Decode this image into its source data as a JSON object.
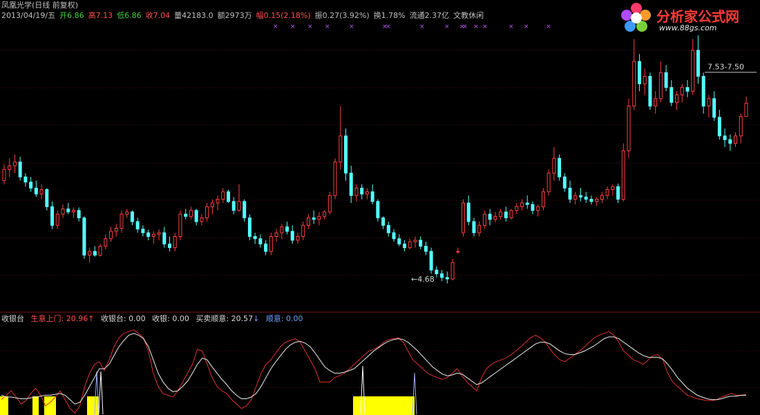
{
  "header": {
    "title": "凤凰光学(日线 前复权)",
    "date": "2013/04/19/五",
    "open_label": "开",
    "open": "6.86",
    "high_label": "高",
    "high": "7.13",
    "low_label": "低",
    "low": "6.86",
    "close_label": "收",
    "close": "7.04",
    "volume_label": "量",
    "volume": "42183.0",
    "amount_label": "额",
    "amount": "2973万",
    "change_label": "幅",
    "change": "0.15(2.18%)",
    "amplitude_label": "振",
    "amplitude": "0.27(3.92%)",
    "turnover_label": "换",
    "turnover": "1.78%",
    "float_label": "流通",
    "float": "2.37亿",
    "sector": "文教休闲"
  },
  "logo": {
    "title": "分析家公式网",
    "url": "www.88gs.com"
  },
  "indicator": {
    "name": "收银台",
    "s1_label": "生意上门:",
    "s1_value": "20.96",
    "s2_label": "收银台:",
    "s2_value": "0.00",
    "s3_label": "收银:",
    "s3_value": "0.00",
    "s4_label": "买卖顺意:",
    "s4_value": "20.57",
    "s5_label": "顺意:",
    "s5_value": "0.00"
  },
  "chart_data": [
    {
      "type": "candlestick",
      "title": "凤凰光学(日线 前复权)",
      "price_range": [
        4.3,
        8.1
      ],
      "annotations": [
        {
          "text": "7.53-7.50",
          "value": 7.52
        },
        {
          "text": "4.68",
          "value": 4.68
        }
      ],
      "colors": {
        "up": "#ff4040",
        "down": "#54ffff"
      },
      "candles": [
        [
          6.0,
          6.22,
          5.95,
          6.15
        ],
        [
          6.15,
          6.3,
          6.05,
          6.2
        ],
        [
          6.2,
          6.35,
          6.1,
          6.25
        ],
        [
          6.25,
          6.32,
          6.0,
          6.05
        ],
        [
          6.05,
          6.1,
          5.92,
          5.98
        ],
        [
          5.98,
          6.05,
          5.85,
          5.9
        ],
        [
          5.9,
          6.0,
          5.78,
          5.82
        ],
        [
          5.82,
          5.95,
          5.75,
          5.88
        ],
        [
          5.88,
          5.9,
          5.6,
          5.65
        ],
        [
          5.65,
          5.72,
          5.35,
          5.4
        ],
        [
          5.4,
          5.6,
          5.35,
          5.55
        ],
        [
          5.55,
          5.68,
          5.5,
          5.62
        ],
        [
          5.62,
          5.7,
          5.55,
          5.58
        ],
        [
          5.58,
          5.64,
          5.5,
          5.6
        ],
        [
          5.6,
          5.64,
          5.45,
          5.5
        ],
        [
          5.5,
          5.52,
          4.95,
          5.0
        ],
        [
          5.0,
          5.1,
          4.9,
          5.05
        ],
        [
          5.05,
          5.12,
          4.98,
          5.0
        ],
        [
          5.0,
          5.15,
          4.98,
          5.12
        ],
        [
          5.12,
          5.28,
          5.08,
          5.22
        ],
        [
          5.22,
          5.38,
          5.18,
          5.32
        ],
        [
          5.32,
          5.42,
          5.25,
          5.36
        ],
        [
          5.36,
          5.6,
          5.3,
          5.55
        ],
        [
          5.55,
          5.62,
          5.5,
          5.58
        ],
        [
          5.58,
          5.6,
          5.4,
          5.45
        ],
        [
          5.45,
          5.5,
          5.3,
          5.35
        ],
        [
          5.35,
          5.4,
          5.25,
          5.3
        ],
        [
          5.3,
          5.34,
          5.2,
          5.25
        ],
        [
          5.25,
          5.32,
          5.15,
          5.28
        ],
        [
          5.28,
          5.35,
          5.2,
          5.3
        ],
        [
          5.3,
          5.38,
          5.1,
          5.15
        ],
        [
          5.15,
          5.25,
          5.05,
          5.1
        ],
        [
          5.1,
          5.3,
          5.05,
          5.25
        ],
        [
          5.25,
          5.6,
          5.2,
          5.55
        ],
        [
          5.55,
          5.62,
          5.48,
          5.52
        ],
        [
          5.52,
          5.65,
          5.48,
          5.6
        ],
        [
          5.6,
          5.62,
          5.4,
          5.45
        ],
        [
          5.45,
          5.55,
          5.4,
          5.5
        ],
        [
          5.5,
          5.7,
          5.45,
          5.65
        ],
        [
          5.65,
          5.75,
          5.55,
          5.7
        ],
        [
          5.7,
          5.8,
          5.6,
          5.75
        ],
        [
          5.75,
          5.9,
          5.7,
          5.85
        ],
        [
          5.85,
          5.88,
          5.7,
          5.72
        ],
        [
          5.72,
          5.78,
          5.55,
          5.6
        ],
        [
          5.6,
          5.95,
          5.58,
          5.72
        ],
        [
          5.72,
          5.75,
          5.45,
          5.5
        ],
        [
          5.5,
          5.55,
          5.2,
          5.25
        ],
        [
          5.25,
          5.3,
          5.15,
          5.22
        ],
        [
          5.22,
          5.28,
          5.1,
          5.15
        ],
        [
          5.15,
          5.2,
          5.0,
          5.05
        ],
        [
          5.05,
          5.3,
          5.0,
          5.25
        ],
        [
          5.25,
          5.35,
          5.18,
          5.3
        ],
        [
          5.3,
          5.42,
          5.22,
          5.38
        ],
        [
          5.38,
          5.45,
          5.28,
          5.32
        ],
        [
          5.32,
          5.4,
          5.15,
          5.2
        ],
        [
          5.2,
          5.3,
          5.15,
          5.25
        ],
        [
          5.25,
          5.45,
          5.2,
          5.4
        ],
        [
          5.4,
          5.55,
          5.35,
          5.5
        ],
        [
          5.5,
          5.6,
          5.42,
          5.48
        ],
        [
          5.48,
          5.58,
          5.4,
          5.52
        ],
        [
          5.52,
          5.6,
          5.48,
          5.58
        ],
        [
          5.58,
          5.85,
          5.55,
          5.8
        ],
        [
          5.8,
          6.3,
          5.75,
          6.25
        ],
        [
          6.25,
          7.0,
          6.15,
          6.6
        ],
        [
          6.6,
          6.7,
          6.0,
          6.1
        ],
        [
          6.1,
          6.2,
          5.7,
          5.8
        ],
        [
          5.8,
          5.95,
          5.72,
          5.9
        ],
        [
          5.9,
          5.95,
          5.75,
          5.82
        ],
        [
          5.82,
          5.9,
          5.75,
          5.85
        ],
        [
          5.85,
          5.95,
          5.68,
          5.72
        ],
        [
          5.72,
          5.75,
          5.45,
          5.5
        ],
        [
          5.5,
          5.52,
          5.35,
          5.4
        ],
        [
          5.4,
          5.45,
          5.25,
          5.3
        ],
        [
          5.3,
          5.35,
          5.18,
          5.22
        ],
        [
          5.22,
          5.28,
          5.12,
          5.15
        ],
        [
          5.15,
          5.2,
          5.05,
          5.1
        ],
        [
          5.1,
          5.22,
          5.08,
          5.18
        ],
        [
          5.18,
          5.25,
          5.1,
          5.2
        ],
        [
          5.2,
          5.25,
          5.08,
          5.12
        ],
        [
          5.12,
          5.18,
          5.0,
          5.05
        ],
        [
          5.05,
          5.1,
          4.75,
          4.8
        ],
        [
          4.8,
          4.85,
          4.7,
          4.75
        ],
        [
          4.75,
          4.8,
          4.65,
          4.7
        ],
        [
          4.7,
          4.78,
          4.62,
          4.68
        ],
        [
          4.68,
          4.95,
          4.66,
          4.9
        ],
        [
          5.05,
          5.1,
          5.02,
          5.05
        ],
        [
          5.3,
          5.75,
          5.25,
          5.7
        ],
        [
          5.7,
          5.8,
          5.4,
          5.45
        ],
        [
          5.45,
          5.5,
          5.25,
          5.3
        ],
        [
          5.3,
          5.45,
          5.25,
          5.4
        ],
        [
          5.4,
          5.6,
          5.35,
          5.55
        ],
        [
          5.55,
          5.62,
          5.4,
          5.48
        ],
        [
          5.48,
          5.58,
          5.44,
          5.52
        ],
        [
          5.52,
          5.62,
          5.48,
          5.58
        ],
        [
          5.58,
          5.65,
          5.45,
          5.5
        ],
        [
          5.5,
          5.62,
          5.48,
          5.6
        ],
        [
          5.6,
          5.7,
          5.55,
          5.65
        ],
        [
          5.65,
          5.75,
          5.6,
          5.7
        ],
        [
          5.7,
          5.8,
          5.62,
          5.68
        ],
        [
          5.68,
          5.72,
          5.55,
          5.6
        ],
        [
          5.6,
          5.68,
          5.52,
          5.65
        ],
        [
          5.65,
          5.9,
          5.6,
          5.85
        ],
        [
          5.85,
          6.15,
          5.8,
          6.1
        ],
        [
          6.1,
          6.45,
          6.0,
          6.3
        ],
        [
          6.3,
          6.35,
          6.0,
          6.05
        ],
        [
          6.05,
          6.1,
          5.85,
          5.9
        ],
        [
          5.9,
          6.0,
          5.7,
          5.75
        ],
        [
          5.75,
          5.85,
          5.68,
          5.8
        ],
        [
          5.8,
          5.9,
          5.72,
          5.78
        ],
        [
          5.78,
          5.85,
          5.7,
          5.75
        ],
        [
          5.75,
          5.8,
          5.68,
          5.72
        ],
        [
          5.72,
          5.78,
          5.66,
          5.75
        ],
        [
          5.75,
          5.85,
          5.7,
          5.8
        ],
        [
          5.8,
          5.92,
          5.75,
          5.88
        ],
        [
          5.88,
          5.95,
          5.8,
          5.92
        ],
        [
          5.92,
          5.96,
          5.7,
          5.75
        ],
        [
          5.75,
          6.5,
          5.72,
          6.4
        ],
        [
          6.4,
          7.1,
          6.3,
          7.0
        ],
        [
          7.0,
          7.9,
          6.95,
          7.6
        ],
        [
          7.6,
          7.7,
          7.2,
          7.3
        ],
        [
          7.3,
          7.5,
          7.15,
          7.4
        ],
        [
          7.4,
          7.45,
          6.95,
          7.0
        ],
        [
          7.0,
          7.2,
          6.9,
          7.1
        ],
        [
          7.1,
          7.6,
          7.05,
          7.45
        ],
        [
          7.45,
          7.55,
          7.2,
          7.25
        ],
        [
          7.25,
          7.35,
          7.0,
          7.05
        ],
        [
          7.05,
          7.2,
          6.95,
          7.15
        ],
        [
          7.15,
          7.3,
          7.05,
          7.25
        ],
        [
          7.25,
          7.35,
          7.12,
          7.2
        ],
        [
          7.2,
          7.9,
          7.15,
          7.75
        ],
        [
          7.75,
          7.95,
          7.3,
          7.4
        ],
        [
          7.4,
          7.45,
          6.9,
          7.0
        ],
        [
          7.0,
          7.15,
          6.85,
          7.1
        ],
        [
          7.1,
          7.2,
          6.8,
          6.85
        ],
        [
          6.85,
          6.95,
          6.55,
          6.6
        ],
        [
          6.6,
          6.7,
          6.45,
          6.55
        ],
        [
          6.55,
          6.62,
          6.4,
          6.5
        ],
        [
          6.5,
          6.65,
          6.45,
          6.6
        ],
        [
          6.6,
          6.9,
          6.5,
          6.86
        ],
        [
          6.86,
          7.13,
          6.86,
          7.04
        ]
      ]
    },
    {
      "type": "line",
      "title": "收银台",
      "y_range": [
        0,
        100
      ],
      "series": [
        {
          "name": "生意上门",
          "color": "#e03030",
          "values": [
            15,
            20,
            25,
            18,
            10,
            14,
            22,
            28,
            20,
            8,
            12,
            18,
            25,
            15,
            5,
            0,
            8,
            30,
            45,
            55,
            58,
            48,
            60,
            75,
            85,
            90,
            92,
            94,
            90,
            85,
            70,
            45,
            30,
            22,
            20,
            18,
            25,
            35,
            45,
            55,
            72,
            70,
            55,
            40,
            30,
            25,
            22,
            15,
            10,
            5,
            8,
            15,
            30,
            45,
            55,
            60,
            68,
            75,
            80,
            82,
            84,
            80,
            70,
            60,
            50,
            35,
            35,
            35,
            40,
            42,
            45,
            50,
            55,
            60,
            65,
            70,
            72,
            75,
            80,
            83,
            84,
            85,
            80,
            70,
            60,
            55,
            50,
            45,
            42,
            40,
            38,
            40,
            45,
            50,
            42,
            35,
            30,
            25,
            40,
            50,
            55,
            58,
            60,
            62,
            66,
            70,
            75,
            80,
            85,
            88,
            85,
            80,
            72,
            65,
            60,
            58,
            62,
            66,
            70,
            75,
            80,
            85,
            88,
            90,
            92,
            88,
            80,
            70,
            65,
            60,
            58,
            55,
            60,
            65,
            66,
            60,
            45,
            35,
            30,
            25,
            20,
            18,
            16,
            15,
            14,
            14,
            15,
            18,
            20,
            22,
            20,
            20,
            21
          ]
        },
        {
          "name": "买卖顺意",
          "color": "#f0f0f0",
          "values": [
            20,
            18,
            18,
            17,
            16,
            16,
            17,
            18,
            19,
            20,
            20,
            21,
            22,
            20,
            15,
            10,
            12,
            20,
            30,
            40,
            50,
            50,
            55,
            65,
            75,
            82,
            88,
            90,
            88,
            84,
            75,
            60,
            45,
            35,
            28,
            24,
            25,
            30,
            36,
            45,
            55,
            62,
            60,
            52,
            45,
            38,
            32,
            25,
            20,
            16,
            16,
            18,
            22,
            30,
            40,
            50,
            58,
            65,
            72,
            77,
            80,
            81,
            79,
            75,
            68,
            60,
            52,
            48,
            45,
            45,
            46,
            48,
            50,
            55,
            60,
            65,
            70,
            74,
            78,
            81,
            83,
            84,
            83,
            80,
            75,
            70,
            64,
            58,
            52,
            48,
            44,
            42,
            43,
            45,
            44,
            40,
            36,
            32,
            34,
            38,
            42,
            46,
            50,
            54,
            58,
            62,
            66,
            70,
            74,
            78,
            80,
            80,
            78,
            74,
            70,
            67,
            66,
            66,
            68,
            70,
            73,
            76,
            80,
            84,
            86,
            86,
            84,
            80,
            76,
            72,
            68,
            65,
            63,
            63,
            63,
            61,
            55,
            48,
            40,
            34,
            28,
            24,
            20,
            18,
            16,
            15,
            15,
            16,
            18,
            19,
            19,
            20,
            20
          ]
        },
        {
          "name": "收银台",
          "color": "#ffff00",
          "type": "histogram",
          "note": "yellow block bars at bottom"
        }
      ]
    }
  ]
}
